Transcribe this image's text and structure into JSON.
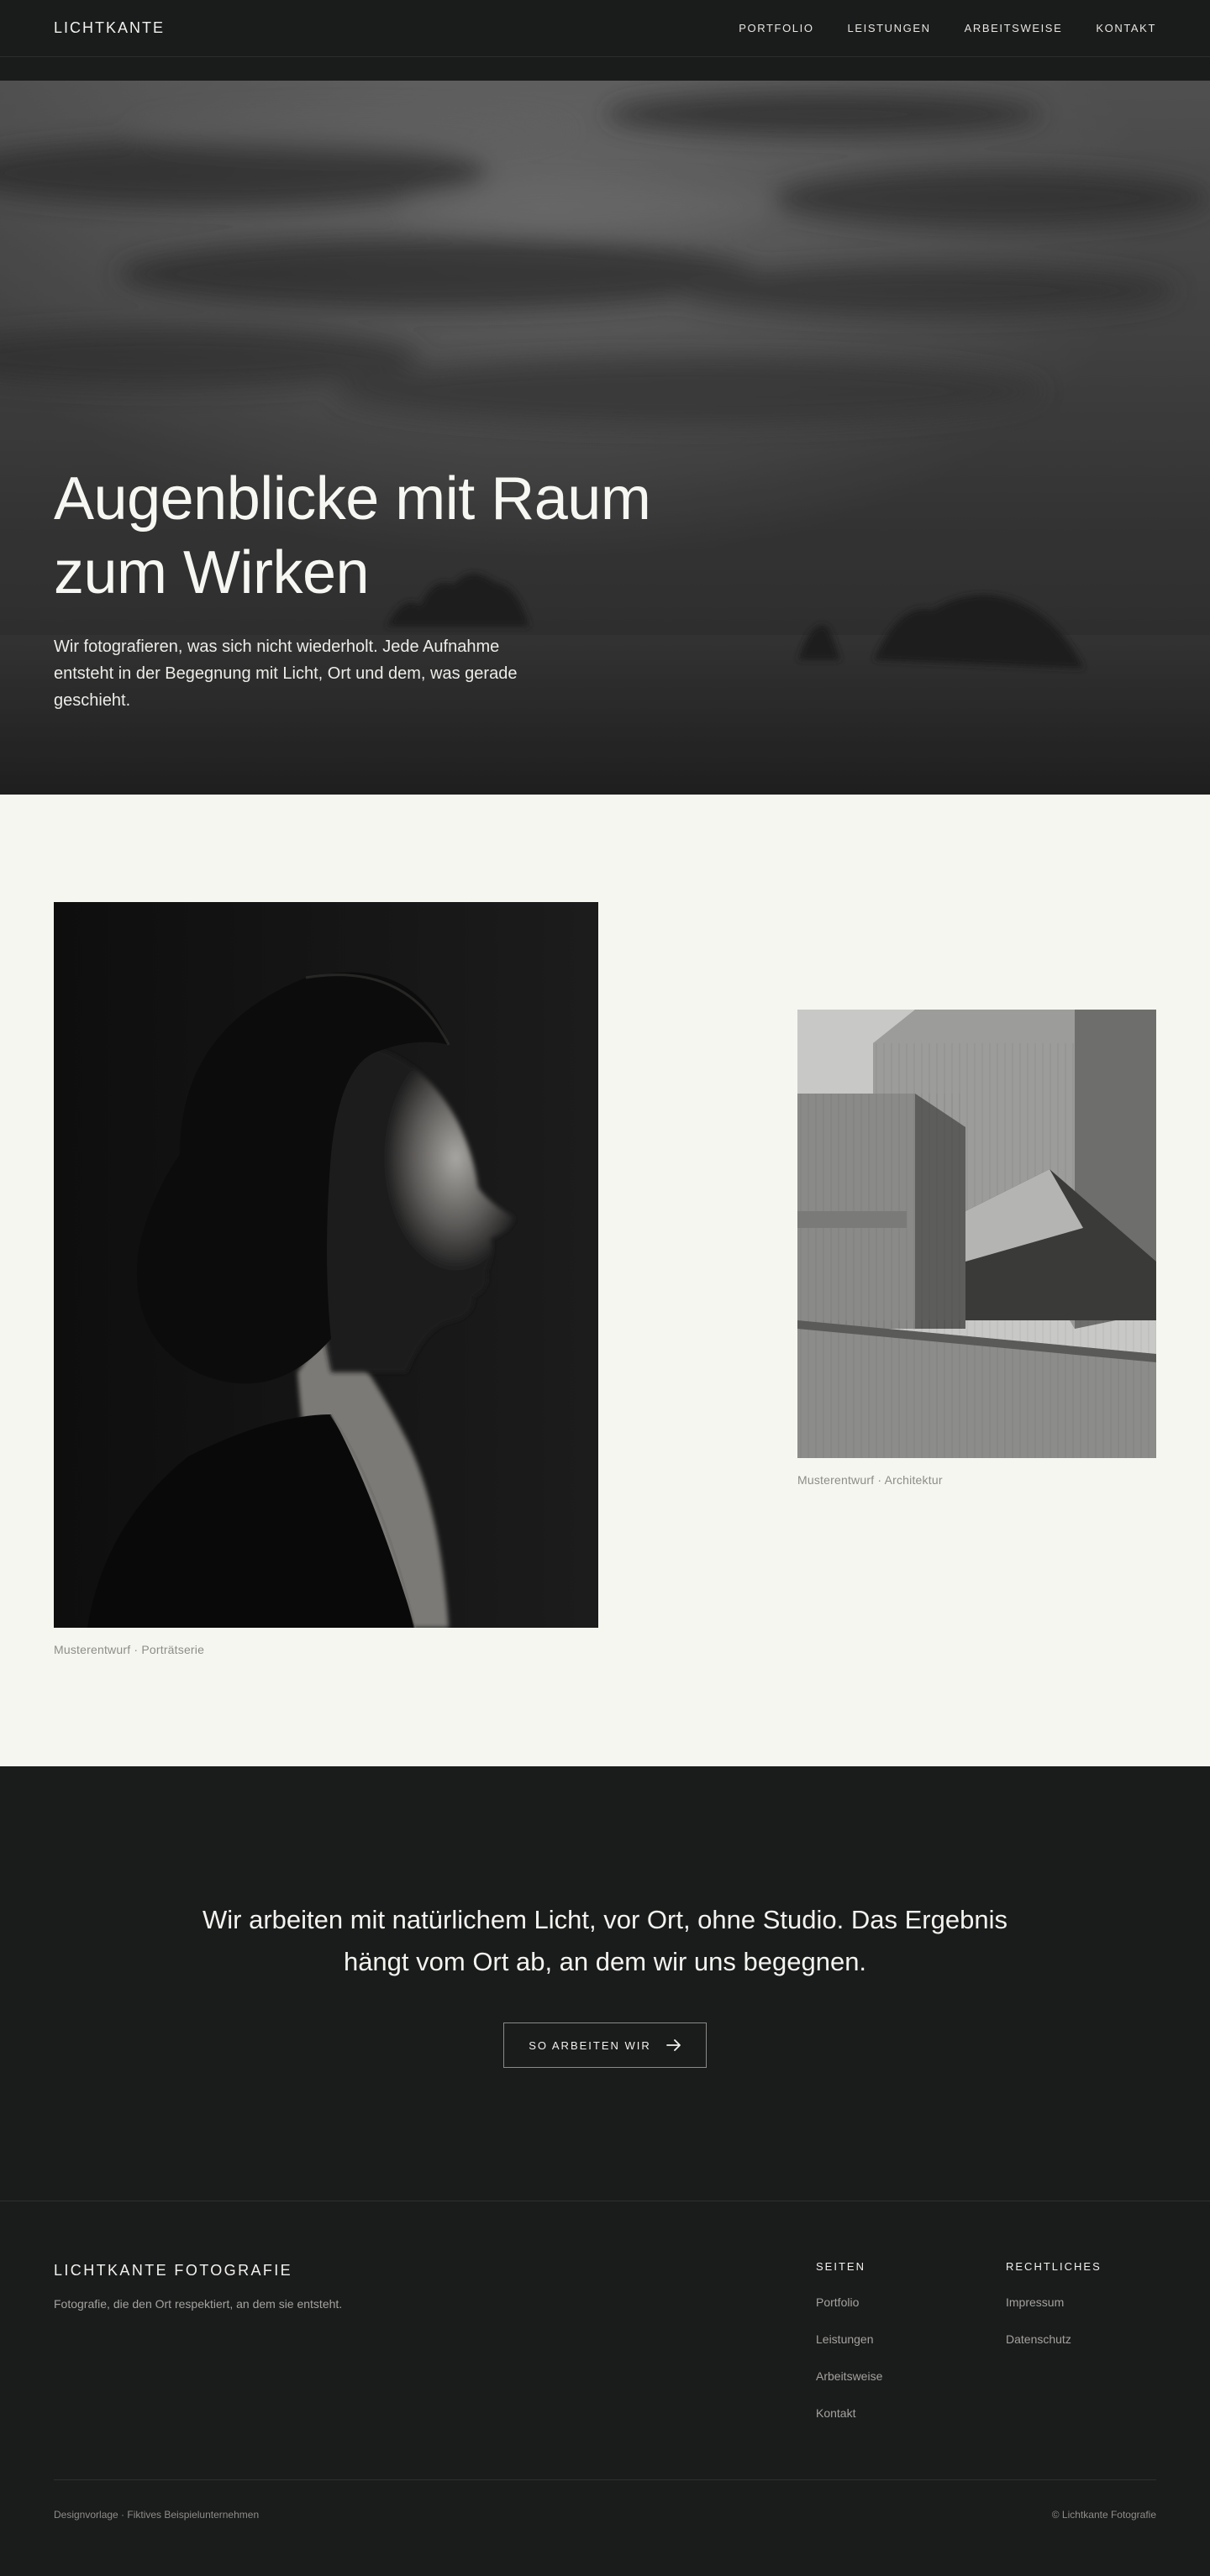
{
  "header": {
    "brand": "LICHTKANTE",
    "nav": [
      {
        "label": "PORTFOLIO"
      },
      {
        "label": "LEISTUNGEN"
      },
      {
        "label": "ARBEITSWEISE"
      },
      {
        "label": "KONTAKT"
      }
    ]
  },
  "hero": {
    "title_line1": "Augenblicke mit Raum",
    "title_line2": "zum Wirken",
    "text": "Wir fotografieren, was sich nicht wiederholt. Jede Aufnahme entsteht in der Begegnung mit Licht, Ort und dem, was gerade geschieht."
  },
  "gallery": {
    "portrait_caption": "Musterentwurf · Porträtserie",
    "architecture_caption": "Musterentwurf · Architektur"
  },
  "approach": {
    "text": "Wir arbeiten mit natürlichem Licht, vor Ort, ohne Studio. Das Ergebnis hängt vom Ort ab, an dem wir uns begegnen.",
    "button_label": "SO ARBEITEN WIR",
    "button_icon": "arrow-right-icon"
  },
  "footer": {
    "brand": "LICHTKANTE FOTOGRAFIE",
    "tagline": "Fotografie, die den Ort respektiert, an dem sie entsteht.",
    "pages_heading": "SEITEN",
    "pages": [
      {
        "label": "Portfolio"
      },
      {
        "label": "Leistungen"
      },
      {
        "label": "Arbeitsweise"
      },
      {
        "label": "Kontakt"
      }
    ],
    "legal_heading": "RECHTLICHES",
    "legal": [
      {
        "label": "Impressum"
      },
      {
        "label": "Datenschutz"
      }
    ],
    "note": "Designvorlage · Fiktives Beispielunternehmen",
    "copyright": "© Lichtkante Fotografie"
  },
  "colors": {
    "dark": "#1a1b1b",
    "light": "#f6f6f1",
    "muted": "#8d8d88"
  }
}
